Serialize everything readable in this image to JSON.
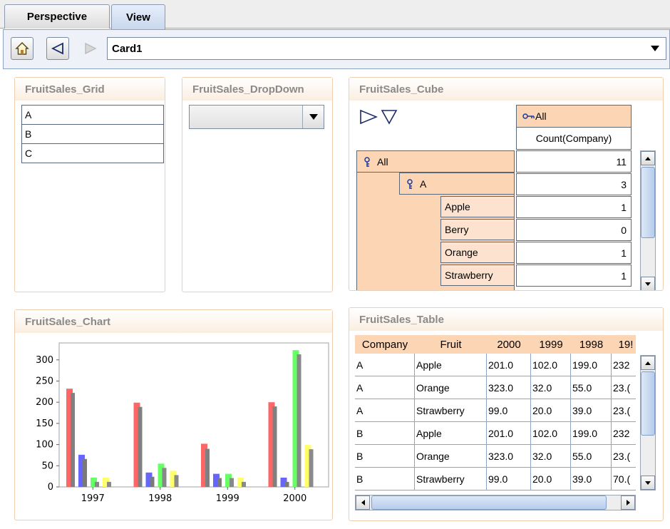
{
  "tabs": [
    {
      "label": "Perspective",
      "active": false
    },
    {
      "label": "View",
      "active": true
    }
  ],
  "nav": {
    "home_icon": "home-icon",
    "back_icon": "back-arrow-icon",
    "forward_icon": "forward-arrow-icon",
    "card_value": "Card1"
  },
  "grid": {
    "title": "FruitSales_Grid",
    "rows": [
      "A",
      "B",
      "C"
    ]
  },
  "dropdown": {
    "title": "FruitSales_DropDown",
    "value": ""
  },
  "cube": {
    "title": "FruitSales_Cube",
    "col_header": "All",
    "measure": "Count(Company)",
    "root_label": "All",
    "group_label": "A",
    "items": [
      "Apple",
      "Berry",
      "Orange",
      "Strawberry"
    ],
    "values": [
      "11",
      "3",
      "1",
      "0",
      "1",
      "1"
    ]
  },
  "chart": {
    "title": "FruitSales_Chart"
  },
  "chart_data": {
    "type": "bar",
    "categories": [
      "1997",
      "1998",
      "1999",
      "2000"
    ],
    "series": [
      {
        "color": "#ff6666",
        "values": [
          232,
          199,
          102,
          200
        ]
      },
      {
        "color": "#808080",
        "values": [
          222,
          189,
          90,
          190
        ]
      },
      {
        "color": "#6666ff",
        "values": [
          76,
          34,
          31,
          22
        ]
      },
      {
        "color": "#7a7a7a",
        "values": [
          66,
          24,
          21,
          12
        ]
      },
      {
        "color": "#66ff66",
        "values": [
          22,
          55,
          31,
          323
        ]
      },
      {
        "color": "#888888",
        "values": [
          12,
          45,
          21,
          313
        ]
      },
      {
        "color": "#ffff66",
        "values": [
          22,
          38,
          22,
          99
        ]
      },
      {
        "color": "#8a8a8a",
        "values": [
          12,
          28,
          12,
          89
        ]
      }
    ],
    "yticks": [
      "0",
      "50",
      "100",
      "150",
      "200",
      "250",
      "300"
    ],
    "ylim": [
      0,
      340
    ],
    "grid": false
  },
  "table": {
    "title": "FruitSales_Table",
    "columns": [
      "Company",
      "Fruit",
      "2000",
      "1999",
      "1998",
      "19!"
    ],
    "rows": [
      [
        "A",
        "Apple",
        "201.0",
        "102.0",
        "199.0",
        "232"
      ],
      [
        "A",
        "Orange",
        "323.0",
        "32.0",
        "55.0",
        "23.("
      ],
      [
        "A",
        "Strawberry",
        "99.0",
        "20.0",
        "39.0",
        "23.("
      ],
      [
        "B",
        "Apple",
        "201.0",
        "102.0",
        "199.0",
        "232"
      ],
      [
        "B",
        "Orange",
        "323.0",
        "32.0",
        "55.0",
        "23.("
      ],
      [
        "B",
        "Strawberry",
        "99.0",
        "20.0",
        "39.0",
        "70.("
      ]
    ]
  }
}
